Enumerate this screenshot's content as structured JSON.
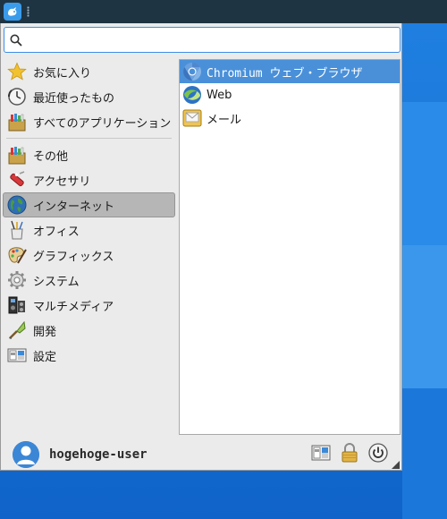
{
  "search": {
    "placeholder": "",
    "value": ""
  },
  "categories": [
    {
      "label": "お気に入り",
      "icon": "star-icon"
    },
    {
      "label": "最近使ったもの",
      "icon": "clock-icon"
    },
    {
      "label": "すべてのアプリケーション",
      "icon": "apps-icon"
    },
    {
      "label": "その他",
      "icon": "misc-icon"
    },
    {
      "label": "アクセサリ",
      "icon": "accessories-icon"
    },
    {
      "label": "インターネット",
      "icon": "globe-icon"
    },
    {
      "label": "オフィス",
      "icon": "office-icon"
    },
    {
      "label": "グラフィックス",
      "icon": "graphics-icon"
    },
    {
      "label": "システム",
      "icon": "system-gear-icon"
    },
    {
      "label": "マルチメディア",
      "icon": "multimedia-icon"
    },
    {
      "label": "開発",
      "icon": "development-icon"
    },
    {
      "label": "設定",
      "icon": "settings-icon"
    }
  ],
  "active_category": "インターネット",
  "apps": [
    {
      "label": "Chromium ウェブ・ブラウザ",
      "icon": "chromium-icon"
    },
    {
      "label": "Web",
      "icon": "web-browser-icon"
    },
    {
      "label": "メール",
      "icon": "mail-icon"
    }
  ],
  "user": {
    "name": "hogehoge-user"
  },
  "colors": {
    "selection": "#4a90d9",
    "panel": "#1f3442",
    "desktop": "#1a74d6"
  }
}
